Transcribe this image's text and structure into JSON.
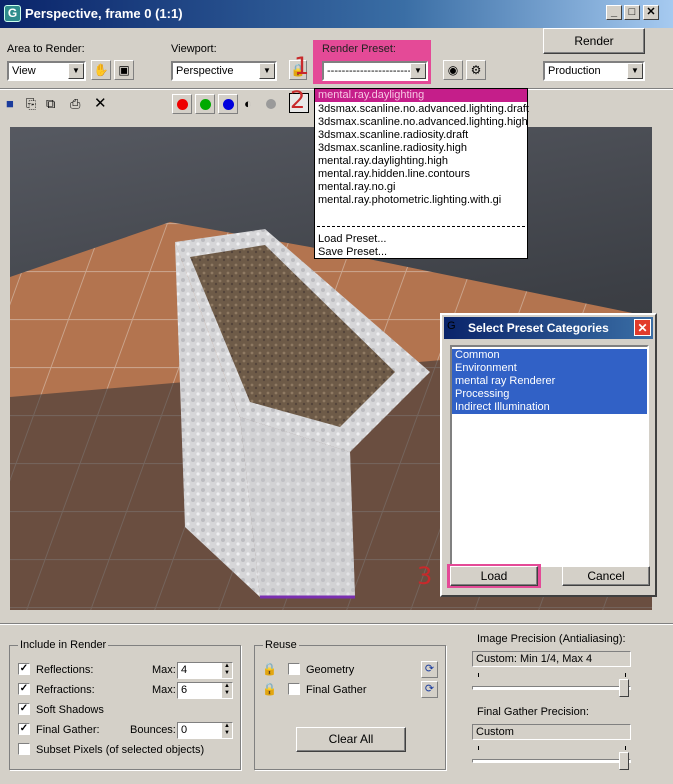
{
  "window": {
    "title": "Perspective, frame 0 (1:1)",
    "buttons": {
      "minimize": "_",
      "maximize": "□",
      "close": "✕"
    }
  },
  "controls": {
    "area_label": "Area to Render:",
    "area_value": "View",
    "viewport_label": "Viewport:",
    "viewport_value": "Perspective",
    "preset_label": "Render Preset:",
    "preset_value": "------------------------",
    "render_button": "Render",
    "production_value": "Production"
  },
  "steps": {
    "one": "1",
    "two": "2",
    "three": "3"
  },
  "preset_menu": {
    "selected": "mental.ray.daylighting",
    "options": [
      "3dsmax.scanline.no.advanced.lighting.draft",
      "3dsmax.scanline.no.advanced.lighting.high",
      "3dsmax.scanline.radiosity.draft",
      "3dsmax.scanline.radiosity.high",
      "mental.ray.daylighting.high",
      "mental.ray.hidden.line.contours",
      "mental.ray.no.gi",
      "mental.ray.photometric.lighting.with.gi"
    ],
    "load": "Load Preset...",
    "save": "Save Preset..."
  },
  "dialog": {
    "title": "Select Preset Categories",
    "categories": [
      "Common",
      "Environment",
      "mental ray Renderer",
      "Processing",
      "Indirect Illumination"
    ],
    "load_button": "Load",
    "cancel_button": "Cancel"
  },
  "include": {
    "group_label": "Include in Render",
    "reflections": "Reflections:",
    "refractions": "Refractions:",
    "soft_shadows": "Soft Shadows",
    "final_gather": "Final Gather:",
    "subset_pixels": "Subset Pixels (of selected objects)",
    "max_label": "Max:",
    "bounces_label": "Bounces:",
    "reflections_max": "4",
    "refractions_max": "6",
    "bounces": "0"
  },
  "reuse": {
    "group_label": "Reuse",
    "geometry": "Geometry",
    "final_gather": "Final Gather",
    "clear_all": "Clear All"
  },
  "precision": {
    "image_label": "Image Precision (Antialiasing):",
    "image_value": "Custom: Min 1/4, Max 4",
    "fg_label": "Final Gather Precision:",
    "fg_value": "Custom"
  }
}
